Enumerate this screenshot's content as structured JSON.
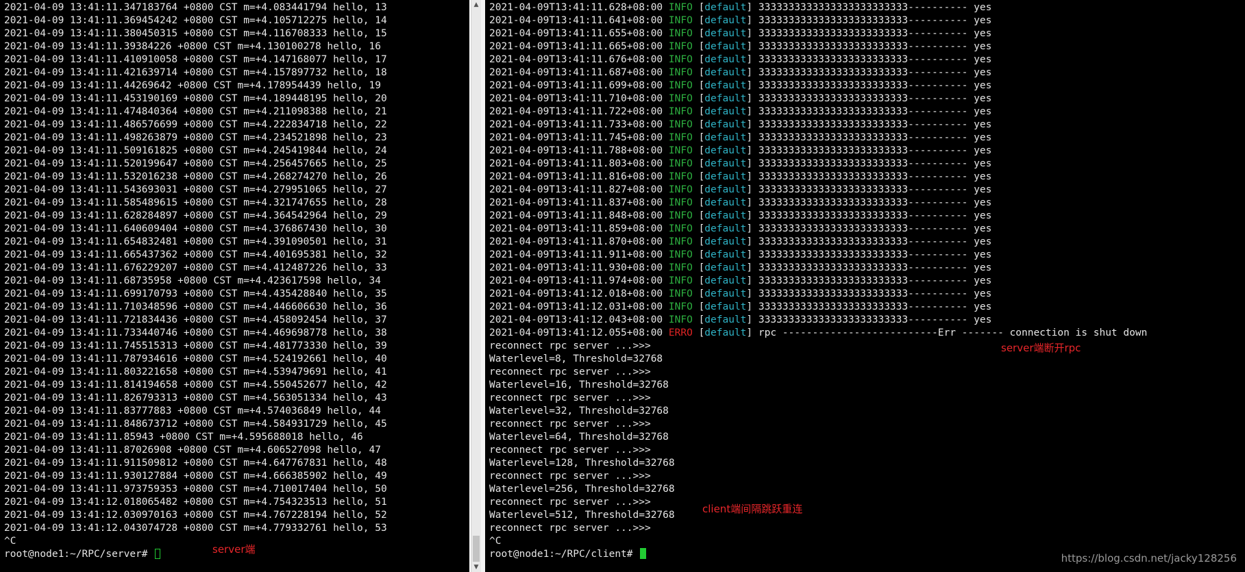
{
  "server": {
    "lines": [
      "2021-04-09 13:41:11.347183764 +0800 CST m=+4.083441794 hello, 13",
      "2021-04-09 13:41:11.369454242 +0800 CST m=+4.105712275 hello, 14",
      "2021-04-09 13:41:11.380450315 +0800 CST m=+4.116708333 hello, 15",
      "2021-04-09 13:41:11.39384226 +0800 CST m=+4.130100278 hello, 16",
      "2021-04-09 13:41:11.410910058 +0800 CST m=+4.147168077 hello, 17",
      "2021-04-09 13:41:11.421639714 +0800 CST m=+4.157897732 hello, 18",
      "2021-04-09 13:41:11.44269642 +0800 CST m=+4.178954439 hello, 19",
      "2021-04-09 13:41:11.453190169 +0800 CST m=+4.189448195 hello, 20",
      "2021-04-09 13:41:11.474840364 +0800 CST m=+4.211098388 hello, 21",
      "2021-04-09 13:41:11.486576699 +0800 CST m=+4.222834718 hello, 22",
      "2021-04-09 13:41:11.498263879 +0800 CST m=+4.234521898 hello, 23",
      "2021-04-09 13:41:11.509161825 +0800 CST m=+4.245419844 hello, 24",
      "2021-04-09 13:41:11.520199647 +0800 CST m=+4.256457665 hello, 25",
      "2021-04-09 13:41:11.532016238 +0800 CST m=+4.268274270 hello, 26",
      "2021-04-09 13:41:11.543693031 +0800 CST m=+4.279951065 hello, 27",
      "2021-04-09 13:41:11.585489615 +0800 CST m=+4.321747655 hello, 28",
      "2021-04-09 13:41:11.628284897 +0800 CST m=+4.364542964 hello, 29",
      "2021-04-09 13:41:11.640609404 +0800 CST m=+4.376867430 hello, 30",
      "2021-04-09 13:41:11.654832481 +0800 CST m=+4.391090501 hello, 31",
      "2021-04-09 13:41:11.665437362 +0800 CST m=+4.401695381 hello, 32",
      "2021-04-09 13:41:11.676229207 +0800 CST m=+4.412487226 hello, 33",
      "2021-04-09 13:41:11.68735958 +0800 CST m=+4.423617598 hello, 34",
      "2021-04-09 13:41:11.699170793 +0800 CST m=+4.435428840 hello, 35",
      "2021-04-09 13:41:11.710348596 +0800 CST m=+4.446606630 hello, 36",
      "2021-04-09 13:41:11.721834436 +0800 CST m=+4.458092454 hello, 37",
      "2021-04-09 13:41:11.733440746 +0800 CST m=+4.469698778 hello, 38",
      "2021-04-09 13:41:11.745515313 +0800 CST m=+4.481773330 hello, 39",
      "2021-04-09 13:41:11.787934616 +0800 CST m=+4.524192661 hello, 40",
      "2021-04-09 13:41:11.803221658 +0800 CST m=+4.539479691 hello, 41",
      "2021-04-09 13:41:11.814194658 +0800 CST m=+4.550452677 hello, 42",
      "2021-04-09 13:41:11.826793313 +0800 CST m=+4.563051334 hello, 43",
      "2021-04-09 13:41:11.83777883 +0800 CST m=+4.574036849 hello, 44",
      "2021-04-09 13:41:11.848673712 +0800 CST m=+4.584931729 hello, 45",
      "2021-04-09 13:41:11.85943 +0800 CST m=+4.595688018 hello, 46",
      "2021-04-09 13:41:11.87026908 +0800 CST m=+4.606527098 hello, 47",
      "2021-04-09 13:41:11.911509812 +0800 CST m=+4.647767831 hello, 48",
      "2021-04-09 13:41:11.930127884 +0800 CST m=+4.666385902 hello, 49",
      "2021-04-09 13:41:11.973759353 +0800 CST m=+4.710017404 hello, 50",
      "2021-04-09 13:41:12.018065482 +0800 CST m=+4.754323513 hello, 51",
      "2021-04-09 13:41:12.030970163 +0800 CST m=+4.767228194 hello, 52",
      "2021-04-09 13:41:12.043074728 +0800 CST m=+4.779332761 hello, 53",
      "^C"
    ],
    "prompt": "root@node1:~/RPC/server# ",
    "annotation": "server端"
  },
  "client": {
    "log_lines": [
      {
        "ts": "2021-04-09T13:41:11.628+08:00",
        "level": "INFO",
        "tag": "default",
        "msg": "3333333333333333333333333---------- yes"
      },
      {
        "ts": "2021-04-09T13:41:11.641+08:00",
        "level": "INFO",
        "tag": "default",
        "msg": "3333333333333333333333333---------- yes"
      },
      {
        "ts": "2021-04-09T13:41:11.655+08:00",
        "level": "INFO",
        "tag": "default",
        "msg": "3333333333333333333333333---------- yes"
      },
      {
        "ts": "2021-04-09T13:41:11.665+08:00",
        "level": "INFO",
        "tag": "default",
        "msg": "3333333333333333333333333---------- yes"
      },
      {
        "ts": "2021-04-09T13:41:11.676+08:00",
        "level": "INFO",
        "tag": "default",
        "msg": "3333333333333333333333333---------- yes"
      },
      {
        "ts": "2021-04-09T13:41:11.687+08:00",
        "level": "INFO",
        "tag": "default",
        "msg": "3333333333333333333333333---------- yes"
      },
      {
        "ts": "2021-04-09T13:41:11.699+08:00",
        "level": "INFO",
        "tag": "default",
        "msg": "3333333333333333333333333---------- yes"
      },
      {
        "ts": "2021-04-09T13:41:11.710+08:00",
        "level": "INFO",
        "tag": "default",
        "msg": "3333333333333333333333333---------- yes"
      },
      {
        "ts": "2021-04-09T13:41:11.722+08:00",
        "level": "INFO",
        "tag": "default",
        "msg": "3333333333333333333333333---------- yes"
      },
      {
        "ts": "2021-04-09T13:41:11.733+08:00",
        "level": "INFO",
        "tag": "default",
        "msg": "3333333333333333333333333---------- yes"
      },
      {
        "ts": "2021-04-09T13:41:11.745+08:00",
        "level": "INFO",
        "tag": "default",
        "msg": "3333333333333333333333333---------- yes"
      },
      {
        "ts": "2021-04-09T13:41:11.788+08:00",
        "level": "INFO",
        "tag": "default",
        "msg": "3333333333333333333333333---------- yes"
      },
      {
        "ts": "2021-04-09T13:41:11.803+08:00",
        "level": "INFO",
        "tag": "default",
        "msg": "3333333333333333333333333---------- yes"
      },
      {
        "ts": "2021-04-09T13:41:11.816+08:00",
        "level": "INFO",
        "tag": "default",
        "msg": "3333333333333333333333333---------- yes"
      },
      {
        "ts": "2021-04-09T13:41:11.827+08:00",
        "level": "INFO",
        "tag": "default",
        "msg": "3333333333333333333333333---------- yes"
      },
      {
        "ts": "2021-04-09T13:41:11.837+08:00",
        "level": "INFO",
        "tag": "default",
        "msg": "3333333333333333333333333---------- yes"
      },
      {
        "ts": "2021-04-09T13:41:11.848+08:00",
        "level": "INFO",
        "tag": "default",
        "msg": "3333333333333333333333333---------- yes"
      },
      {
        "ts": "2021-04-09T13:41:11.859+08:00",
        "level": "INFO",
        "tag": "default",
        "msg": "3333333333333333333333333---------- yes"
      },
      {
        "ts": "2021-04-09T13:41:11.870+08:00",
        "level": "INFO",
        "tag": "default",
        "msg": "3333333333333333333333333---------- yes"
      },
      {
        "ts": "2021-04-09T13:41:11.911+08:00",
        "level": "INFO",
        "tag": "default",
        "msg": "3333333333333333333333333---------- yes"
      },
      {
        "ts": "2021-04-09T13:41:11.930+08:00",
        "level": "INFO",
        "tag": "default",
        "msg": "3333333333333333333333333---------- yes"
      },
      {
        "ts": "2021-04-09T13:41:11.974+08:00",
        "level": "INFO",
        "tag": "default",
        "msg": "3333333333333333333333333---------- yes"
      },
      {
        "ts": "2021-04-09T13:41:12.018+08:00",
        "level": "INFO",
        "tag": "default",
        "msg": "3333333333333333333333333---------- yes"
      },
      {
        "ts": "2021-04-09T13:41:12.031+08:00",
        "level": "INFO",
        "tag": "default",
        "msg": "3333333333333333333333333---------- yes"
      },
      {
        "ts": "2021-04-09T13:41:12.043+08:00",
        "level": "INFO",
        "tag": "default",
        "msg": "3333333333333333333333333---------- yes"
      },
      {
        "ts": "2021-04-09T13:41:12.055+08:00",
        "level": "ERRO",
        "tag": "default",
        "msg": "rpc --------------------------Err ------- connection is shut down"
      }
    ],
    "plain_lines": [
      "reconnect rpc server ...>>>",
      "Waterlevel=8, Threshold=32768",
      "reconnect rpc server ...>>>",
      "Waterlevel=16, Threshold=32768",
      "reconnect rpc server ...>>>",
      "Waterlevel=32, Threshold=32768",
      "reconnect rpc server ...>>>",
      "Waterlevel=64, Threshold=32768",
      "reconnect rpc server ...>>>",
      "Waterlevel=128, Threshold=32768",
      "reconnect rpc server ...>>>",
      "Waterlevel=256, Threshold=32768",
      "reconnect rpc server ...>>>",
      "Waterlevel=512, Threshold=32768",
      "reconnect rpc server ...>>>",
      "^C"
    ],
    "prompt": "root@node1:~/RPC/client# ",
    "annotation_disconnect": "server端断开rpc",
    "annotation_reconnect": "client端间隔跳跃重连"
  },
  "watermark": "https://blog.csdn.net/jacky128256",
  "colors": {
    "info": "#2db040",
    "error": "#e02424",
    "tag": "#2fb3c6",
    "annotation": "#e8262a",
    "cursor": "#22cc33"
  }
}
